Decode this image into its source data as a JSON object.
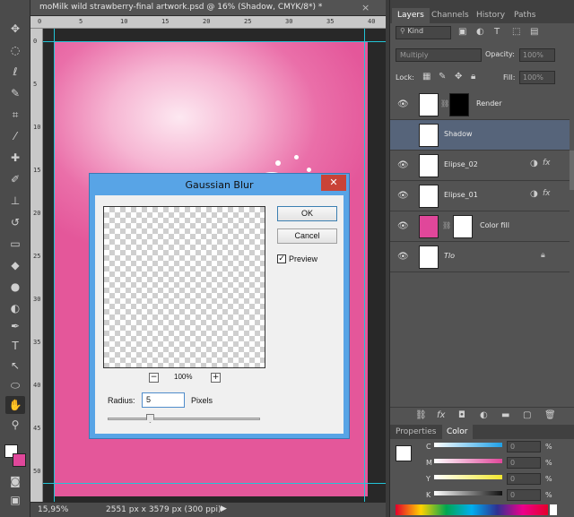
{
  "document": {
    "tab_title": "moMilk wild strawberry-final artwork.psd @ 16% (Shadow, CMYK/8*) *",
    "tab_close": "×"
  },
  "rulers": {
    "top_ticks": [
      "0",
      "5",
      "10",
      "15",
      "20",
      "25",
      "30",
      "35",
      "40"
    ],
    "left_ticks": [
      "0",
      "5",
      "10",
      "15",
      "20",
      "25",
      "30",
      "35",
      "40",
      "45",
      "50"
    ]
  },
  "status_bar": {
    "zoom": "15,95%",
    "doc_info": "2551 px x 3579 px (300 ppi)"
  },
  "toolbar": {
    "tools": [
      "move-tool",
      "marquee-tool",
      "lasso-tool",
      "quick-select-tool",
      "crop-tool",
      "eyedropper-tool",
      "healing-tool",
      "brush-tool",
      "stamp-tool",
      "history-brush-tool",
      "eraser-tool",
      "gradient-tool",
      "blur-tool",
      "dodge-tool",
      "pen-tool",
      "type-tool",
      "path-select-tool",
      "shape-tool",
      "hand-tool",
      "zoom-tool"
    ],
    "foreground_color": "#ffffff",
    "background_color": "#e0479a"
  },
  "panel": {
    "tabs": [
      "Layers",
      "Channels",
      "History",
      "Paths"
    ],
    "filter_kind": "Kind",
    "blend_mode": "Multiply",
    "opacity_label": "Opacity:",
    "opacity_value": "100%",
    "lock_label": "Lock:",
    "fill_label": "Fill:",
    "fill_value": "100%",
    "layers": [
      {
        "name": "Render",
        "selected": false,
        "fx": false,
        "lock": false
      },
      {
        "name": "Shadow",
        "selected": true,
        "fx": false,
        "lock": false
      },
      {
        "name": "Elipse_02",
        "selected": false,
        "fx": true,
        "lock": false
      },
      {
        "name": "Elipse_01",
        "selected": false,
        "fx": true,
        "lock": false
      },
      {
        "name": "Color fill",
        "selected": false,
        "fx": false,
        "lock": false
      },
      {
        "name": "Tlo",
        "selected": false,
        "fx": false,
        "lock": true
      }
    ],
    "fx_label": "fx"
  },
  "color_panel": {
    "tabs": [
      "Properties",
      "Color"
    ],
    "active_tab": "Color",
    "sliders": [
      {
        "label": "C",
        "value": "0",
        "unit": "%"
      },
      {
        "label": "M",
        "value": "0",
        "unit": "%"
      },
      {
        "label": "Y",
        "value": "0",
        "unit": "%"
      },
      {
        "label": "K",
        "value": "0",
        "unit": "%"
      }
    ]
  },
  "dialog": {
    "title": "Gaussian Blur",
    "ok_label": "OK",
    "cancel_label": "Cancel",
    "preview_label": "Preview",
    "preview_checked": true,
    "zoom_out": "−",
    "zoom_in": "+",
    "zoom_level": "100%",
    "radius_label": "Radius:",
    "radius_value": "5",
    "radius_unit": "Pixels",
    "radius_slider_fraction": 0.27
  },
  "colors": {
    "artboard_pink": "#e4579a",
    "guide": "#22c4d6",
    "dialog_frame": "#58a4e6",
    "close_red": "#c94337",
    "selected_layer": "#56647a"
  }
}
